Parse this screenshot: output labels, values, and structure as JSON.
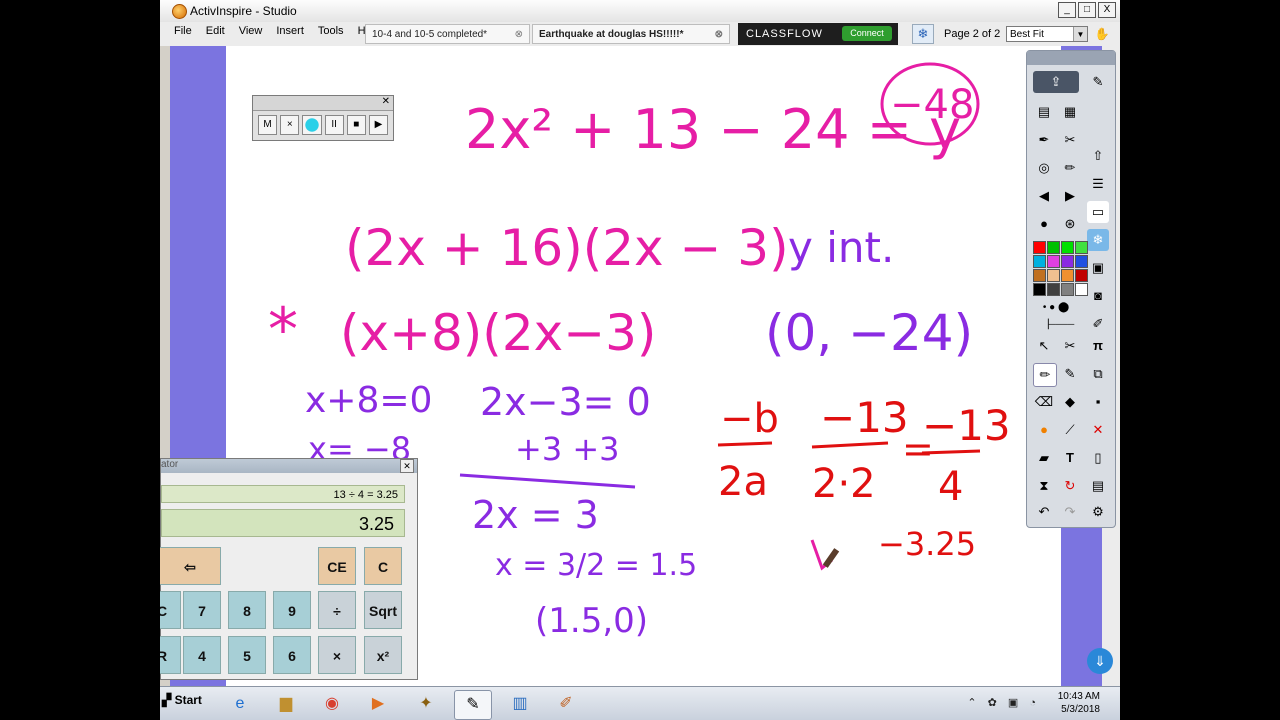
{
  "window": {
    "title": "ActivInspire - Studio",
    "controls": [
      "_",
      "□",
      "X"
    ]
  },
  "menu": [
    "File",
    "Edit",
    "View",
    "Insert",
    "Tools",
    "Help"
  ],
  "tabs": [
    {
      "label": "10-4 and 10-5 completed*"
    },
    {
      "label": "Earthquake at douglas HS!!!!!*"
    }
  ],
  "classflow": {
    "label": "CLASSFLOW",
    "connect": "Connect"
  },
  "page_info": "Page 2 of 2",
  "fit_select": "Best Fit",
  "recorder": {
    "buttons": [
      "M",
      "×",
      "",
      "II",
      "■",
      "▶"
    ]
  },
  "calculator": {
    "title": "ator",
    "expression": "13 ÷ 4 = 3.25",
    "display": "3.25",
    "keys": {
      "backspace": "⇦",
      "ce": "CE",
      "c": "C",
      "mc": "C",
      "seven": "7",
      "eight": "8",
      "nine": "9",
      "divide": "÷",
      "sqrt": "Sqrt",
      "mr": "R",
      "four": "4",
      "five": "5",
      "six": "6",
      "multiply": "×",
      "square": "x²"
    }
  },
  "ink": {
    "line1": "2x² + 13 − 24 = y",
    "circled": "−48",
    "line2": "(2x + 16)(2x − 3)",
    "yint_label": "y int.",
    "line3": "(x+8)(2x−3)",
    "star": "*",
    "yint_point": "(0, −24)",
    "eq1": "x+8=0",
    "eq1b": "x= −8",
    "eq2": "2x−3= 0",
    "eq2b": "+3   +3",
    "eq2c": "2x  = 3",
    "eq2d": "x = 3/2 = 1.5",
    "point2": "(1.5,0)",
    "vertex_num": "−b",
    "vertex_den": "2a",
    "v2_num": "−13",
    "v2_den": "2·2",
    "v3_num": "−13",
    "v3_den": "4",
    "result": "−3.25"
  },
  "taskbar": {
    "start": "Start",
    "time": "10:43 AM",
    "date": "5/3/2018"
  },
  "colors": {
    "ink_pink": "#e61ea5",
    "ink_purple": "#8a2be2",
    "ink_red": "#e01010",
    "gutter": "#7b74e0"
  }
}
